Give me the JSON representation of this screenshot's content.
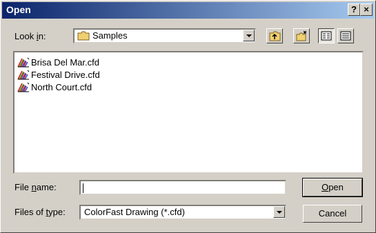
{
  "window": {
    "title": "Open",
    "help_label": "?",
    "close_label": "×"
  },
  "lookin": {
    "label_pre": "Look ",
    "label_key": "i",
    "label_post": "n:",
    "value": "Samples"
  },
  "toolbar": {
    "up_icon": "up-one-level-icon",
    "newfolder_icon": "new-folder-icon",
    "list_icon": "list-view-icon",
    "details_icon": "details-view-icon"
  },
  "files": [
    {
      "name": "Brisa Del Mar.cfd"
    },
    {
      "name": "Festival Drive.cfd"
    },
    {
      "name": "North Court.cfd"
    }
  ],
  "filename": {
    "label_pre": "File ",
    "label_key": "n",
    "label_post": "ame:",
    "value": ""
  },
  "filetype": {
    "label_pre": "Files of ",
    "label_key": "t",
    "label_post": "ype:",
    "value": "ColorFast Drawing (*.cfd)"
  },
  "buttons": {
    "open_key": "O",
    "open_rest": "pen",
    "cancel": "Cancel"
  }
}
